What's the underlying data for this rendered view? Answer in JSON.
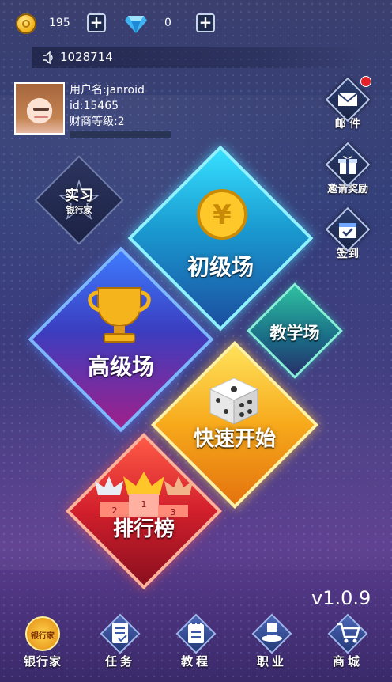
{
  "header": {
    "coins": "195",
    "gems": "0",
    "broadcast": "1028714"
  },
  "profile": {
    "username": "用户名:janroid",
    "id": "id:15465",
    "level": "财商等级:2"
  },
  "side_menu": {
    "mail_label": "邮 件",
    "invite_label": "邀请奖励",
    "checkin_label": "签到"
  },
  "badge": {
    "line1": "实习",
    "line2": "银行家"
  },
  "tiles": {
    "beginner": "初级场",
    "advanced": "高级场",
    "tutorial": "教学场",
    "quick_start": "快速开始",
    "ranking": "排行榜",
    "podium_numbers": [
      "2",
      "1",
      "3"
    ]
  },
  "version": "v1.0.9",
  "bottom_nav": {
    "banker_icon_text": "银行家",
    "banker": "银行家",
    "tasks": "任务",
    "tutorial": "教程",
    "career": "职业",
    "shop": "商城"
  },
  "colors": {
    "beginner": "#1fb3d8",
    "advanced": "#3a4cc8",
    "tutorial": "#1f8f7a",
    "quick_start": "#f5a21a",
    "ranking": "#d63030"
  }
}
